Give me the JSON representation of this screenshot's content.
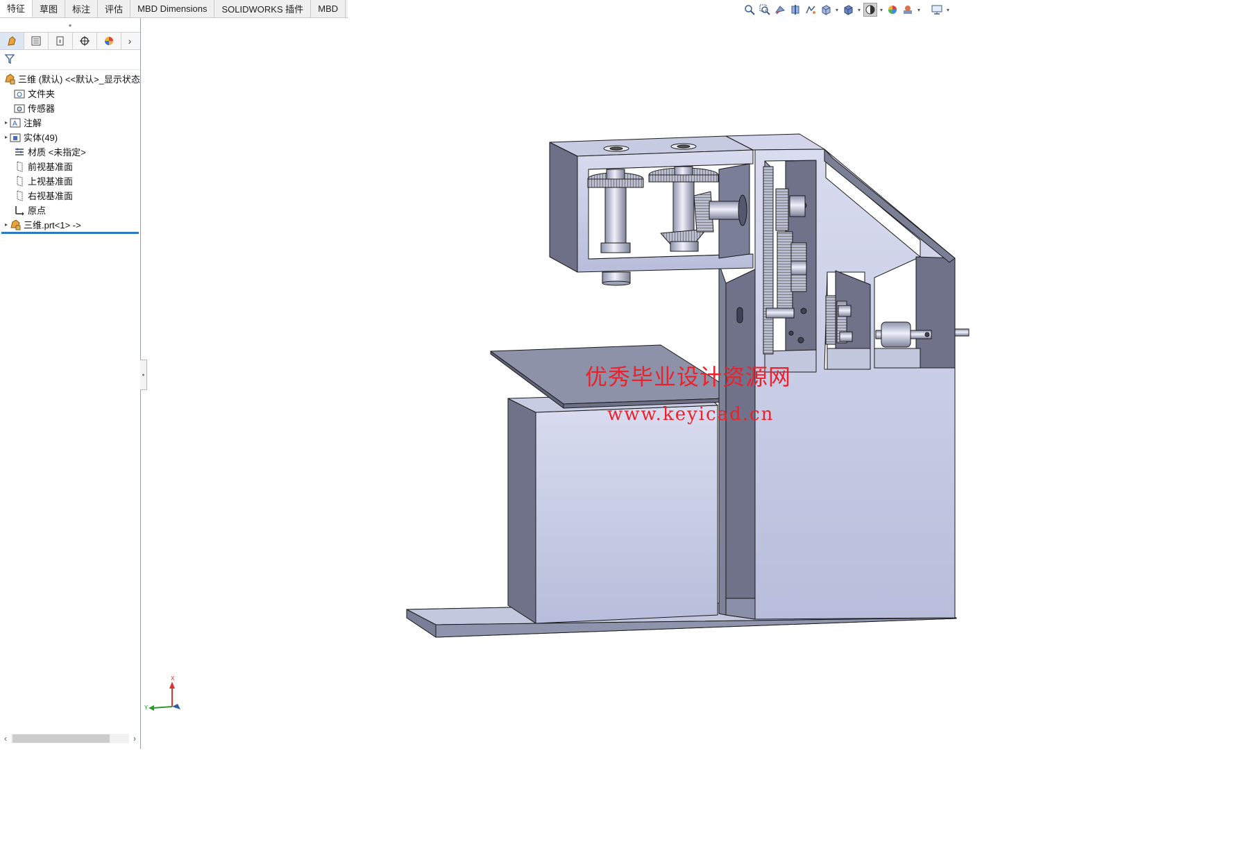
{
  "tabs": [
    "特征",
    "草图",
    "标注",
    "评估",
    "MBD Dimensions",
    "SOLIDWORKS 插件",
    "MBD"
  ],
  "active_tab": 0,
  "hud_icons": [
    "zoom-to-fit-icon",
    "zoom-area-icon",
    "previous-view-icon",
    "section-view-icon",
    "dynamic-annotation-icon",
    "view-orientation-icon",
    "display-style-icon",
    "hide-show-icon",
    "edit-appearance-icon",
    "apply-scene-icon",
    "view-settings-icon"
  ],
  "panel_tabs": [
    "feature-manager-icon",
    "property-manager-icon",
    "configuration-manager-icon",
    "dimxpert-manager-icon",
    "display-manager-icon"
  ],
  "tree": {
    "root": "三维 (默认) <<默认>_显示状态",
    "items": [
      {
        "label": "文件夹",
        "icon": "history-folder-icon",
        "expandable": false
      },
      {
        "label": "传感器",
        "icon": "sensors-icon",
        "expandable": false
      },
      {
        "label": "注解",
        "icon": "annotations-icon",
        "expandable": true
      },
      {
        "label": "实体(49)",
        "icon": "solid-bodies-icon",
        "expandable": true
      },
      {
        "label": "材质 <未指定>",
        "icon": "material-icon",
        "expandable": false
      },
      {
        "label": "前视基准面",
        "icon": "plane-icon",
        "expandable": false
      },
      {
        "label": "上视基准面",
        "icon": "plane-icon",
        "expandable": false
      },
      {
        "label": "右视基准面",
        "icon": "plane-icon",
        "expandable": false
      },
      {
        "label": "原点",
        "icon": "origin-icon",
        "expandable": false
      },
      {
        "label": "三维.prt<1> ->",
        "icon": "part-icon",
        "expandable": true
      }
    ]
  },
  "watermark": {
    "line1": "优秀毕业设计资源网",
    "line2": "www.keyicad.cn",
    "color": "#e8232d"
  },
  "triad": {
    "x_label": "X",
    "y_label": "Y"
  },
  "colors": {
    "model_face_light": "#c7cce6",
    "model_face_mid": "#a4a9c4",
    "model_face_dark": "#6e7186",
    "model_edge": "#1a1a1a",
    "selection_blue": "#2b79c2"
  }
}
